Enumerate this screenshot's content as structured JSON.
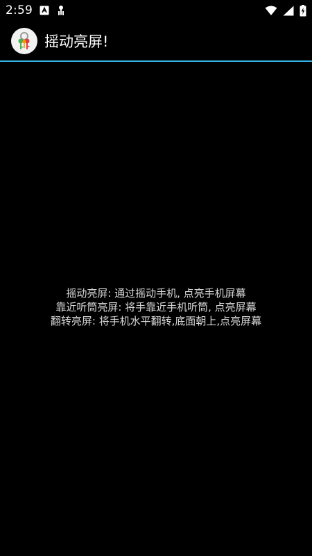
{
  "status_bar": {
    "time": "2:59",
    "left_icons": [
      "android-debug-icon",
      "app-notification-icon"
    ],
    "right_icons": [
      "wifi-icon",
      "signal-icon",
      "battery-charging-icon"
    ]
  },
  "app_bar": {
    "title": "摇动亮屏!",
    "icon": "keys-icon",
    "accent_color": "#33b5e5"
  },
  "content": {
    "lines": [
      "摇动亮屏: 通过摇动手机, 点亮手机屏幕",
      "靠近听筒亮屏: 将手靠近手机听筒, 点亮屏幕",
      "翻转亮屏: 将手机水平翻转,底面朝上,点亮屏幕"
    ]
  }
}
